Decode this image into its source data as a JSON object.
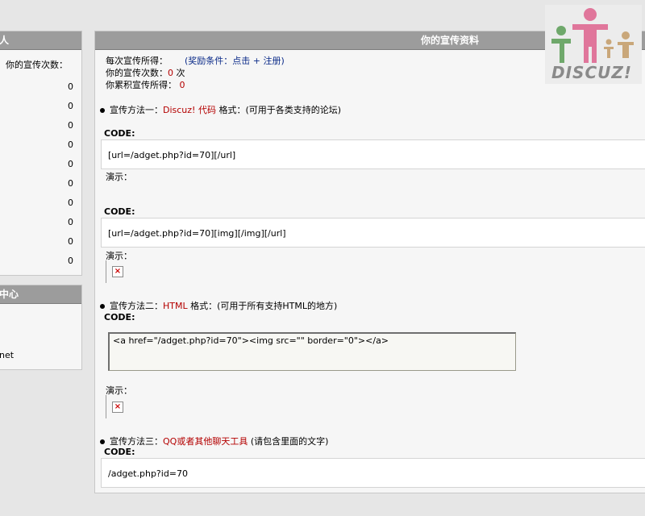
{
  "left_stats": {
    "header": "人",
    "col_label": "你的宣传次数：",
    "rows": [
      "0",
      "0",
      "0",
      "0",
      "0",
      "0",
      "0",
      "0",
      "0",
      "0"
    ]
  },
  "left_menu": {
    "header": "中心",
    "item": "net"
  },
  "main": {
    "header": "你的宣传资料",
    "reward_label": "每次宣传所得：",
    "reward_link": "(奖励条件：点击 + 注册)",
    "count_label": "你的宣传次数：",
    "count_value": "0",
    "count_unit": "次",
    "total_label": "你累积宣传所得：",
    "total_value": "0",
    "method1_prefix": "宣传方法一：",
    "method1_name": "Discuz! 代码",
    "method1_suffix": "格式：(可用于各类支持的论坛)",
    "code_label": "CODE:",
    "code1": "[url=/adget.php?id=70][/url]",
    "demo_label": "演示：",
    "code2": "[url=/adget.php?id=70][img][/img][/url]",
    "method2_prefix": "宣传方法二：",
    "method2_name": "HTML",
    "method2_suffix": "格式：(可用于所有支持HTML的地方)",
    "code3": "<a href=\"/adget.php?id=70\"><img src=\"\" border=\"0\"></a>",
    "method3_prefix": "宣传方法三：",
    "method3_name": "QQ或者其他聊天工具",
    "method3_suffix": "(请包含里面的文字)",
    "code4": "/adget.php?id=70"
  },
  "logo": {
    "text": "DISCUZ!",
    "colors": {
      "green": "#6fa86b",
      "pink": "#e0769b",
      "tan": "#c9a77a",
      "text": "#8a8a8a"
    }
  }
}
